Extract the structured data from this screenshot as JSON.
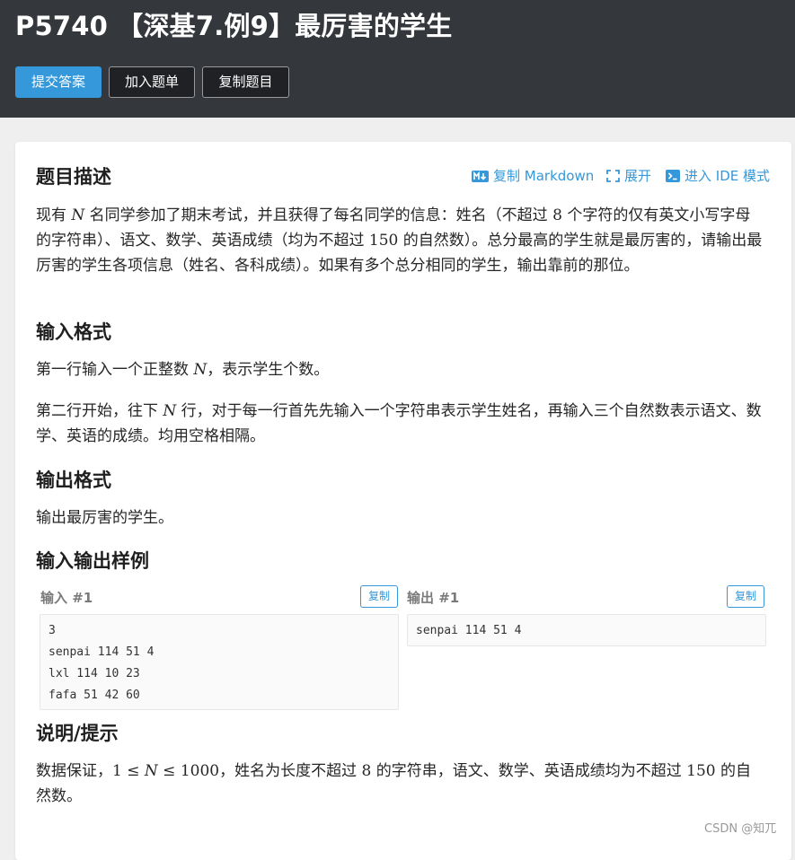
{
  "problem": {
    "title": "P5740 【深基7.例9】最厉害的学生"
  },
  "toolbar": {
    "submit_label": "提交答案",
    "add_list_label": "加入题单",
    "copy_problem_label": "复制题目"
  },
  "actions": {
    "copy_markdown": "复制 Markdown",
    "expand": "展开",
    "ide_mode": "进入 IDE 模式"
  },
  "sections": {
    "description": {
      "heading": "题目描述",
      "text_1": "现有 ",
      "var_n": "N",
      "text_2": " 名同学参加了期末考试，并且获得了每名同学的信息：姓名（不超过 ",
      "num_8": "8",
      "text_3": " 个字符的仅有英文小写字母的字符串）、语文、数学、英语成绩（均为不超过 ",
      "num_150": "150",
      "text_4": " 的自然数）。总分最高的学生就是最厉害的，请输出最厉害的学生各项信息（姓名、各科成绩）。如果有多个总分相同的学生，输出靠前的那位。"
    },
    "input_format": {
      "heading": "输入格式",
      "line1_a": "第一行输入一个正整数 ",
      "line1_var": "N",
      "line1_b": "，表示学生个数。",
      "line2_a": "第二行开始，往下 ",
      "line2_var": "N",
      "line2_b": " 行，对于每一行首先先输入一个字符串表示学生姓名，再输入三个自然数表示语文、数学、英语的成绩。均用空格相隔。"
    },
    "output_format": {
      "heading": "输出格式",
      "text": "输出最厉害的学生。"
    },
    "samples": {
      "heading": "输入输出样例",
      "input_label": "输入 #1",
      "output_label": "输出 #1",
      "copy_label": "复制",
      "input_lines": [
        "3",
        "senpai 114 51 4",
        "lxl 114 10 23",
        "fafa 51 42 60"
      ],
      "output_lines": [
        "senpai 114 51 4"
      ]
    },
    "hint": {
      "heading": "说明/提示",
      "text_a": "数据保证，",
      "math_1": "1",
      "math_le": "≤",
      "math_n": "N",
      "math_1000": "1000",
      "text_b": "，姓名为长度不超过 ",
      "num_8": "8",
      "text_c": " 的字符串，语文、数学、英语成绩均为不超过 ",
      "num_150": "150",
      "text_d": " 的自然数。"
    }
  },
  "watermark": "CSDN @知兀",
  "colors": {
    "header_bg": "#34373b",
    "accent": "#3498db",
    "page_bg": "#efefef"
  }
}
